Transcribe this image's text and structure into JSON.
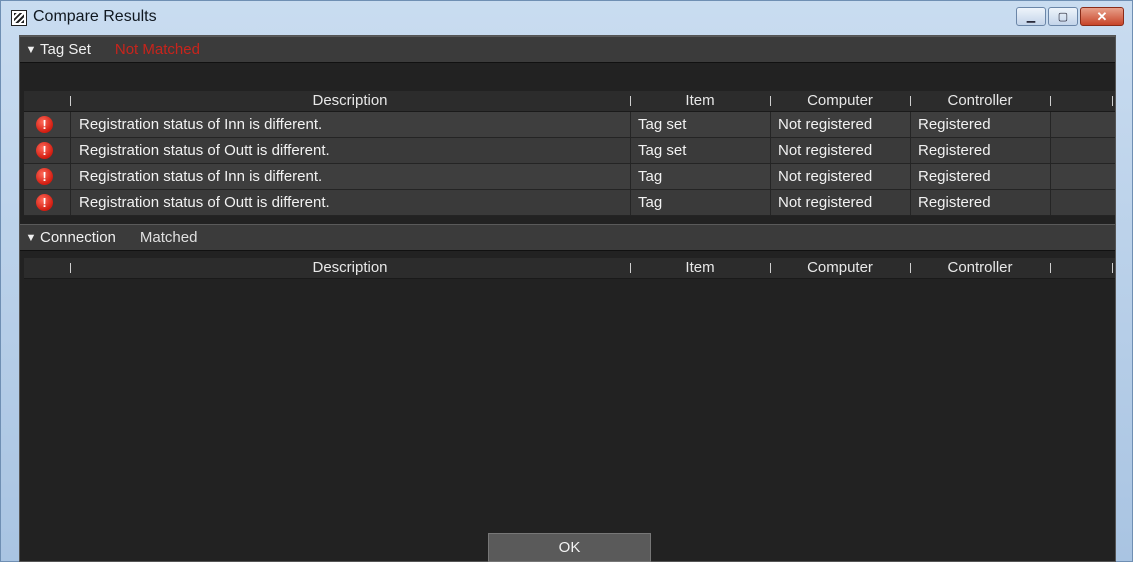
{
  "window": {
    "title": "Compare Results",
    "controls": {
      "minimize": "▁",
      "maximize": "▢",
      "close": "✕"
    }
  },
  "sections": [
    {
      "arrow": "▼",
      "title": "Tag Set",
      "status": "Not Matched",
      "status_color": "#c8241c",
      "columns": [
        "Description",
        "Item",
        "Computer",
        "Controller"
      ],
      "rows": [
        {
          "icon": "warning-icon",
          "description": "Registration status of Inn is different.",
          "item": "Tag set",
          "computer": "Not registered",
          "controller": "Registered"
        },
        {
          "icon": "warning-icon",
          "description": "Registration status of Outt is different.",
          "item": "Tag set",
          "computer": "Not registered",
          "controller": "Registered"
        },
        {
          "icon": "warning-icon",
          "description": "Registration status of Inn is different.",
          "item": "Tag",
          "computer": "Not registered",
          "controller": "Registered"
        },
        {
          "icon": "warning-icon",
          "description": "Registration status of Outt is different.",
          "item": "Tag",
          "computer": "Not registered",
          "controller": "Registered"
        }
      ]
    },
    {
      "arrow": "▼",
      "title": "Connection",
      "status": "Matched",
      "columns": [
        "Description",
        "Item",
        "Computer",
        "Controller"
      ],
      "rows": []
    }
  ],
  "ok_label": "OK"
}
